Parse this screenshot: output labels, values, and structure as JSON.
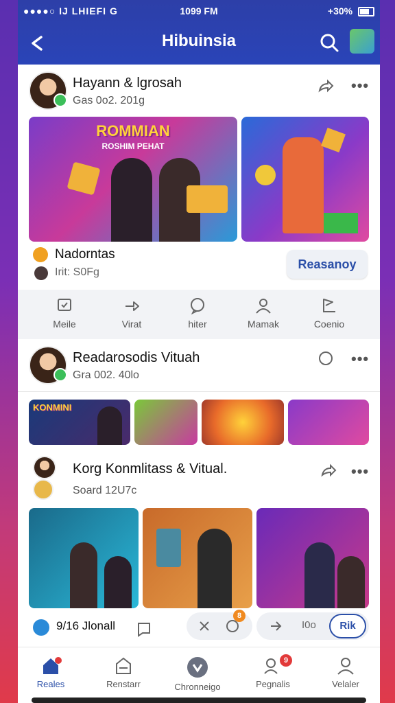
{
  "status_bar": {
    "carrier": "●●●●○ IJ LHIEFI G",
    "time": "1099 FM",
    "battery": "+30%"
  },
  "header": {
    "title": "Hibuinsia"
  },
  "posts": [
    {
      "name": "Hayann & lgrosah",
      "sub": "Gas 0o2. 201g",
      "image_label": "ROMMIAN",
      "image_sublabel": "ROSHIM PEHAT",
      "tag": "Nadorntas",
      "tag_sub": "Irit: S0Fg",
      "button": "Reasanoy"
    },
    {
      "name": "Readarosodis Vituah",
      "sub": "Gra 002. 40lo",
      "image_label": "KONMINI"
    },
    {
      "name": "Korg Konmlitass & Vitual.",
      "sub": "Soard 12U7c"
    }
  ],
  "actions": [
    {
      "label": "Meile",
      "icon": "message-square-icon"
    },
    {
      "label": "Virat",
      "icon": "share-arrow-icon"
    },
    {
      "label": "hiter",
      "icon": "chat-bubble-icon"
    },
    {
      "label": "Mamak",
      "icon": "person-icon"
    },
    {
      "label": "Coenio",
      "icon": "flag-icon"
    }
  ],
  "footer": {
    "count_label": "9/16 Jlonall",
    "counter_text": "I0o",
    "badge": "8",
    "pill_button": "Rik"
  },
  "nav": [
    {
      "label": "Reales",
      "icon": "home-icon",
      "active": true
    },
    {
      "label": "Renstarr",
      "icon": "store-icon",
      "active": false
    },
    {
      "label": "Chronneigo",
      "icon": "compass-icon",
      "active": false
    },
    {
      "label": "Pegnalis",
      "icon": "people-icon",
      "active": false,
      "badge": "9"
    },
    {
      "label": "Velaler",
      "icon": "profile-icon",
      "active": false
    }
  ],
  "colors": {
    "header": "#2a44b8",
    "accent": "#2b4fa8",
    "badge": "#e23a3a"
  }
}
